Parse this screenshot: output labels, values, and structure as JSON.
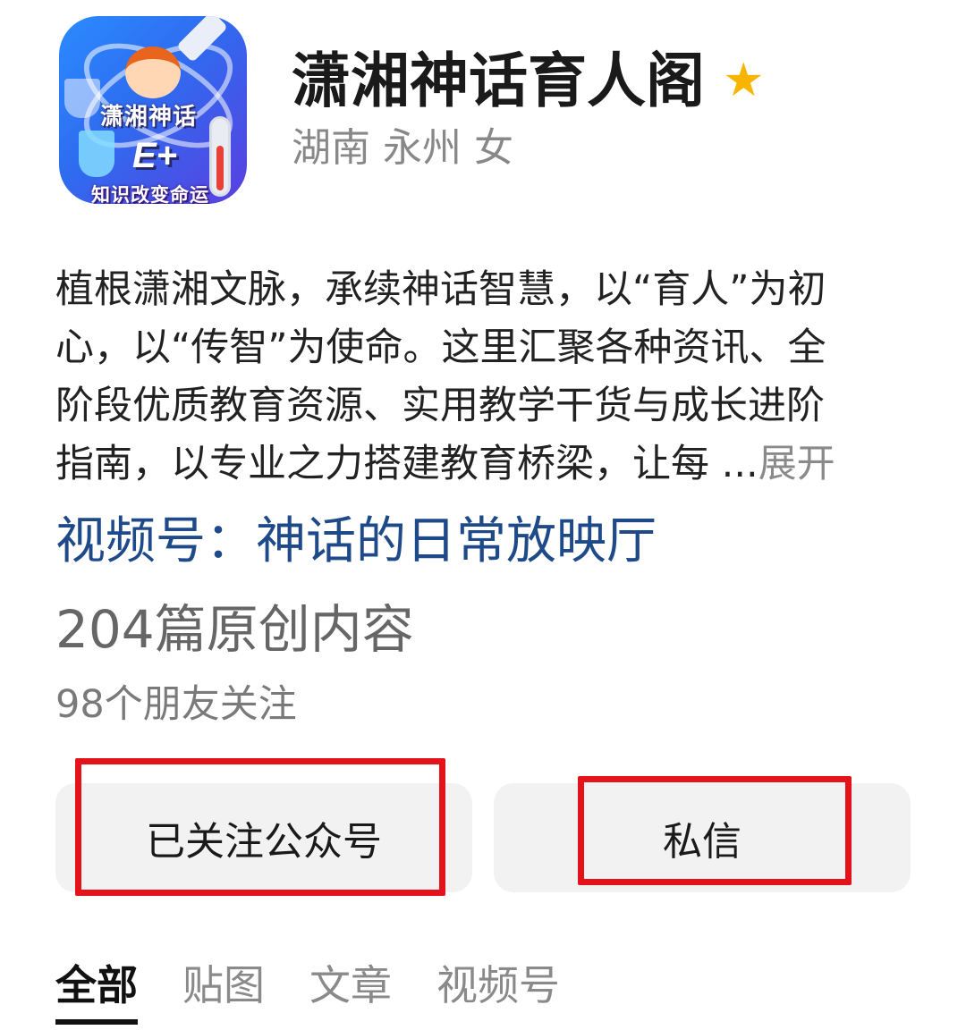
{
  "profile": {
    "name": "潇湘神话育人阁",
    "star_icon": "star-icon",
    "location": "湖南 永州 女",
    "avatar": {
      "title": "潇湘神话",
      "badge": "E+",
      "slogan": "知识改变命运"
    }
  },
  "bio": {
    "lines": [
      "植根潇湘文脉，承续神话智慧，以“育人”为初",
      "心，以“传智”为使命。这里汇聚各种资讯、全",
      "阶段优质教育资源、实用教学干货与成长进阶",
      "指南，以专业之力搭建教育桥梁，让每 "
    ],
    "ellipsis": "...",
    "expand_label": "展开"
  },
  "channel": "视频号：神话的日常放映厅",
  "original_count": "204篇原创内容",
  "friends_following": "98个朋友关注",
  "actions": {
    "follow_label": "已关注公众号",
    "message_label": "私信"
  },
  "tabs": [
    {
      "label": "全部",
      "active": true
    },
    {
      "label": "贴图",
      "active": false
    },
    {
      "label": "文章",
      "active": false
    },
    {
      "label": "视频号",
      "active": false
    }
  ],
  "colors": {
    "highlight": "#e4121b",
    "channel_link": "#1f4a8a",
    "star": "#f7b500"
  }
}
